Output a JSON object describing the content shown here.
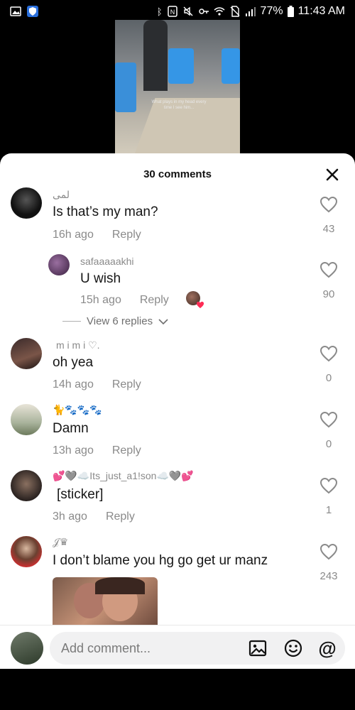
{
  "status_bar": {
    "battery": "77%",
    "time": "11:43 AM"
  },
  "video": {
    "caption": "What plays in my head every time I see him..."
  },
  "comments_header": {
    "title": "30 comments"
  },
  "comments": [
    {
      "username": "لمى",
      "text": "Is that’s my man?",
      "time": "16h ago",
      "reply": "Reply",
      "likes": "43"
    },
    {
      "username": "safaaaaakhi",
      "text": "U wish",
      "time": "15h ago",
      "reply": "Reply",
      "likes": "90"
    },
    {
      "username": "m i m i ♡.",
      "text": "oh yea",
      "time": "14h ago",
      "reply": "Reply",
      "likes": "0"
    },
    {
      "username": "🐈🐾🐾🐾",
      "text": "Damn",
      "time": "13h ago",
      "reply": "Reply",
      "likes": "0"
    },
    {
      "username": "💕🩶☁️Its_just_a1!son☁️🩶💕",
      "text": "[sticker]",
      "time": "3h ago",
      "reply": "Reply",
      "likes": "1"
    },
    {
      "username": "𝒥♛",
      "text": "I don’t blame you hg go get ur manz",
      "likes": "243"
    }
  ],
  "view_replies": {
    "label": "View 6 replies"
  },
  "input": {
    "placeholder": "Add comment..."
  },
  "colors": {
    "like_heart": "#8a8a8a",
    "reply_heart": "#fe2c55"
  }
}
